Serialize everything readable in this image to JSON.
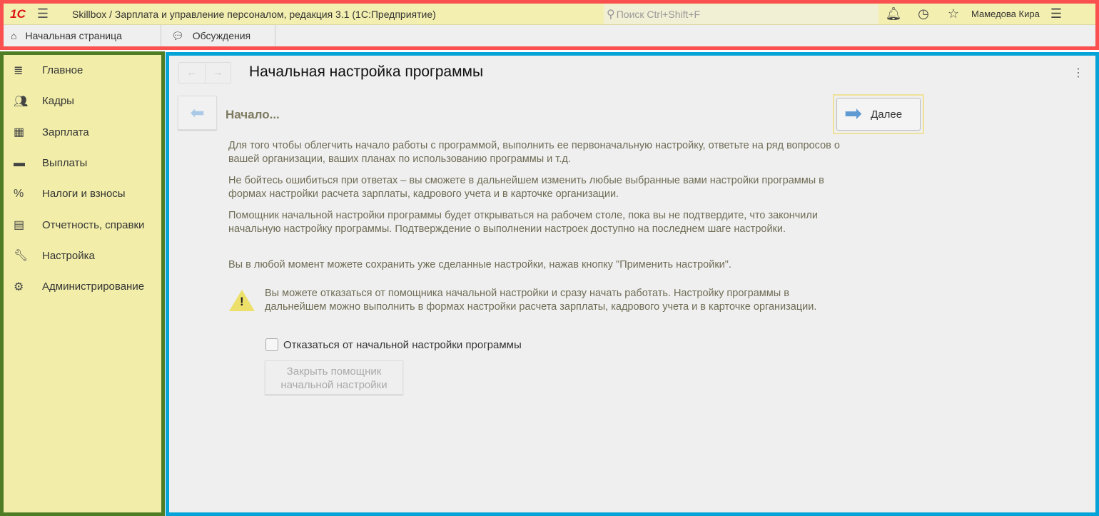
{
  "header": {
    "logo": "1С",
    "title": "Skillbox / Зарплата и управление персоналом, редакция 3.1  (1С:Предприятие)",
    "search_placeholder": "Поиск Ctrl+Shift+F",
    "user": "Мамедова Кира"
  },
  "tabs": [
    {
      "label": "Начальная страница"
    },
    {
      "label": "Обсуждения"
    }
  ],
  "sidebar": {
    "items": [
      {
        "label": "Главное"
      },
      {
        "label": "Кадры"
      },
      {
        "label": "Зарплата"
      },
      {
        "label": "Выплаты"
      },
      {
        "label": "Налоги и взносы"
      },
      {
        "label": "Отчетность, справки"
      },
      {
        "label": "Настройка"
      },
      {
        "label": "Администрирование"
      }
    ]
  },
  "form": {
    "title": "Начальная настройка программы",
    "step": "Начало...",
    "next_label": "Далее",
    "paragraphs": [
      "Для того чтобы облегчить начало работы с программой, выполнить ее первоначальную настройку, ответьте на ряд вопросов о вашей организации, ваших планах по использованию программы и т.д.",
      "Не бойтесь ошибиться при ответах – вы сможете в дальнейшем изменить любые выбранные вами настройки программы в формах настройки расчета зарплаты, кадрового учета и в карточке организации.",
      "Помощник начальной настройки программы будет открываться на рабочем столе, пока вы не подтвердите, что закончили начальную настройку программы. Подтверждение о выполнении настроек доступно на последнем шаге настройки.",
      "Вы в любой момент можете сохранить уже сделанные настройки, нажав кнопку \"Применить настройки\"."
    ],
    "warning": "Вы можете отказаться от помощника начальной настройки и сразу начать работать. Настройку программы в дальнейшем можно выполнить в формах настройки расчета зарплаты, кадрового учета и в карточке организации.",
    "checkbox_label": "Отказаться от начальной настройки программы",
    "checkbox_checked": false,
    "close_label": "Закрыть помощник начальной настройки"
  }
}
